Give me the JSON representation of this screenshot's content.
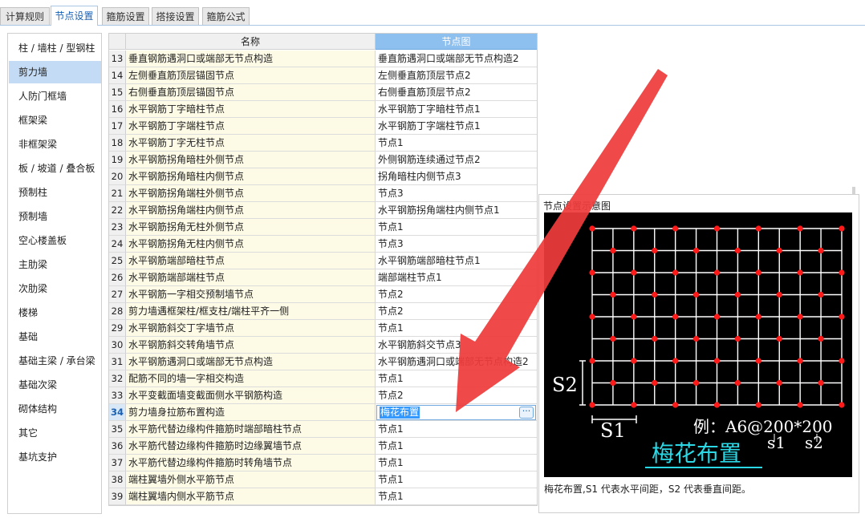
{
  "tabs": [
    "计算规则",
    "节点设置",
    "箍筋设置",
    "搭接设置",
    "箍筋公式"
  ],
  "active_tab": 1,
  "sidebar": {
    "selected": 1,
    "items": [
      "柱 / 墙柱 / 型钢柱",
      "剪力墙",
      "人防门框墙",
      "框架梁",
      "非框架梁",
      "板 / 坡道 / 叠合板",
      "预制柱",
      "预制墙",
      "空心楼盖板",
      "主肋梁",
      "次肋梁",
      "楼梯",
      "基础",
      "基础主梁 / 承台梁",
      "基础次梁",
      "砌体结构",
      "其它",
      "基坑支护"
    ]
  },
  "grid": {
    "header_name": "名称",
    "header_node": "节点图",
    "current_row": 34,
    "rows": [
      {
        "num": "13",
        "name": "垂直钢筋遇洞口或端部无节点构造",
        "node": "垂直筋遇洞口或端部无节点构造2"
      },
      {
        "num": "14",
        "name": "左侧垂直筋顶层锚固节点",
        "node": "左侧垂直筋顶层节点2"
      },
      {
        "num": "15",
        "name": "右侧垂直筋顶层锚固节点",
        "node": "右侧垂直筋顶层节点2"
      },
      {
        "num": "16",
        "name": "水平钢筋丁字暗柱节点",
        "node": "水平钢筋丁字暗柱节点1"
      },
      {
        "num": "17",
        "name": "水平钢筋丁字端柱节点",
        "node": "水平钢筋丁字端柱节点1"
      },
      {
        "num": "18",
        "name": "水平钢筋丁字无柱节点",
        "node": "节点1"
      },
      {
        "num": "19",
        "name": "水平钢筋拐角暗柱外侧节点",
        "node": "外侧钢筋连续通过节点2"
      },
      {
        "num": "20",
        "name": "水平钢筋拐角暗柱内侧节点",
        "node": "拐角暗柱内侧节点3"
      },
      {
        "num": "21",
        "name": "水平钢筋拐角端柱外侧节点",
        "node": "节点3"
      },
      {
        "num": "22",
        "name": "水平钢筋拐角端柱内侧节点",
        "node": "水平钢筋拐角端柱内侧节点1"
      },
      {
        "num": "23",
        "name": "水平钢筋拐角无柱外侧节点",
        "node": "节点1"
      },
      {
        "num": "24",
        "name": "水平钢筋拐角无柱内侧节点",
        "node": "节点3"
      },
      {
        "num": "25",
        "name": "水平钢筋端部暗柱节点",
        "node": "水平钢筋端部暗柱节点1"
      },
      {
        "num": "26",
        "name": "水平钢筋端部端柱节点",
        "node": "端部端柱节点1"
      },
      {
        "num": "27",
        "name": "水平钢筋一字相交预制墙节点",
        "node": "节点2"
      },
      {
        "num": "28",
        "name": "剪力墙遇框架柱/框支柱/端柱平齐一侧",
        "node": "节点2"
      },
      {
        "num": "29",
        "name": "水平钢筋斜交丁字墙节点",
        "node": "节点1"
      },
      {
        "num": "30",
        "name": "水平钢筋斜交转角墙节点",
        "node": "水平钢筋斜交节点3"
      },
      {
        "num": "31",
        "name": "水平钢筋遇洞口或端部无节点构造",
        "node": "水平钢筋遇洞口或端部无节点构造2"
      },
      {
        "num": "32",
        "name": "配筋不同的墙一字相交构造",
        "node": "节点1"
      },
      {
        "num": "33",
        "name": "水平变截面墙变截面侧水平钢筋构造",
        "node": "节点2"
      },
      {
        "num": "34",
        "name": "剪力墙身拉筋布置构造",
        "node": "梅花布置"
      },
      {
        "num": "35",
        "name": "水平筋代替边缘构件箍筋时端部暗柱节点",
        "node": "节点1"
      },
      {
        "num": "36",
        "name": "水平筋代替边缘构件箍筋时边缘翼墙节点",
        "node": "节点1"
      },
      {
        "num": "37",
        "name": "水平筋代替边缘构件箍筋时转角墙节点",
        "node": "节点1"
      },
      {
        "num": "38",
        "name": "端柱翼墙外侧水平筋节点",
        "node": "节点1"
      },
      {
        "num": "39",
        "name": "端柱翼墙内侧水平筋节点",
        "node": "节点1"
      }
    ],
    "ellipsis_label": "···"
  },
  "preview": {
    "title": "节点设置示意图",
    "s2_label": "S2",
    "s1_label": "S1",
    "example_text": "例：A6@200*200",
    "s1_small": "s1",
    "s2_small": "s2",
    "pattern_label": "梅花布置",
    "caption": "梅花布置,S1 代表水平间距，S2 代表垂直间距。",
    "colors": {
      "grid": "#ffffff",
      "dot": "#ff1a1a",
      "cyan": "#2ad8e6",
      "bg": "#000000"
    }
  },
  "overlay_arrow_color": "#ee3b3b"
}
